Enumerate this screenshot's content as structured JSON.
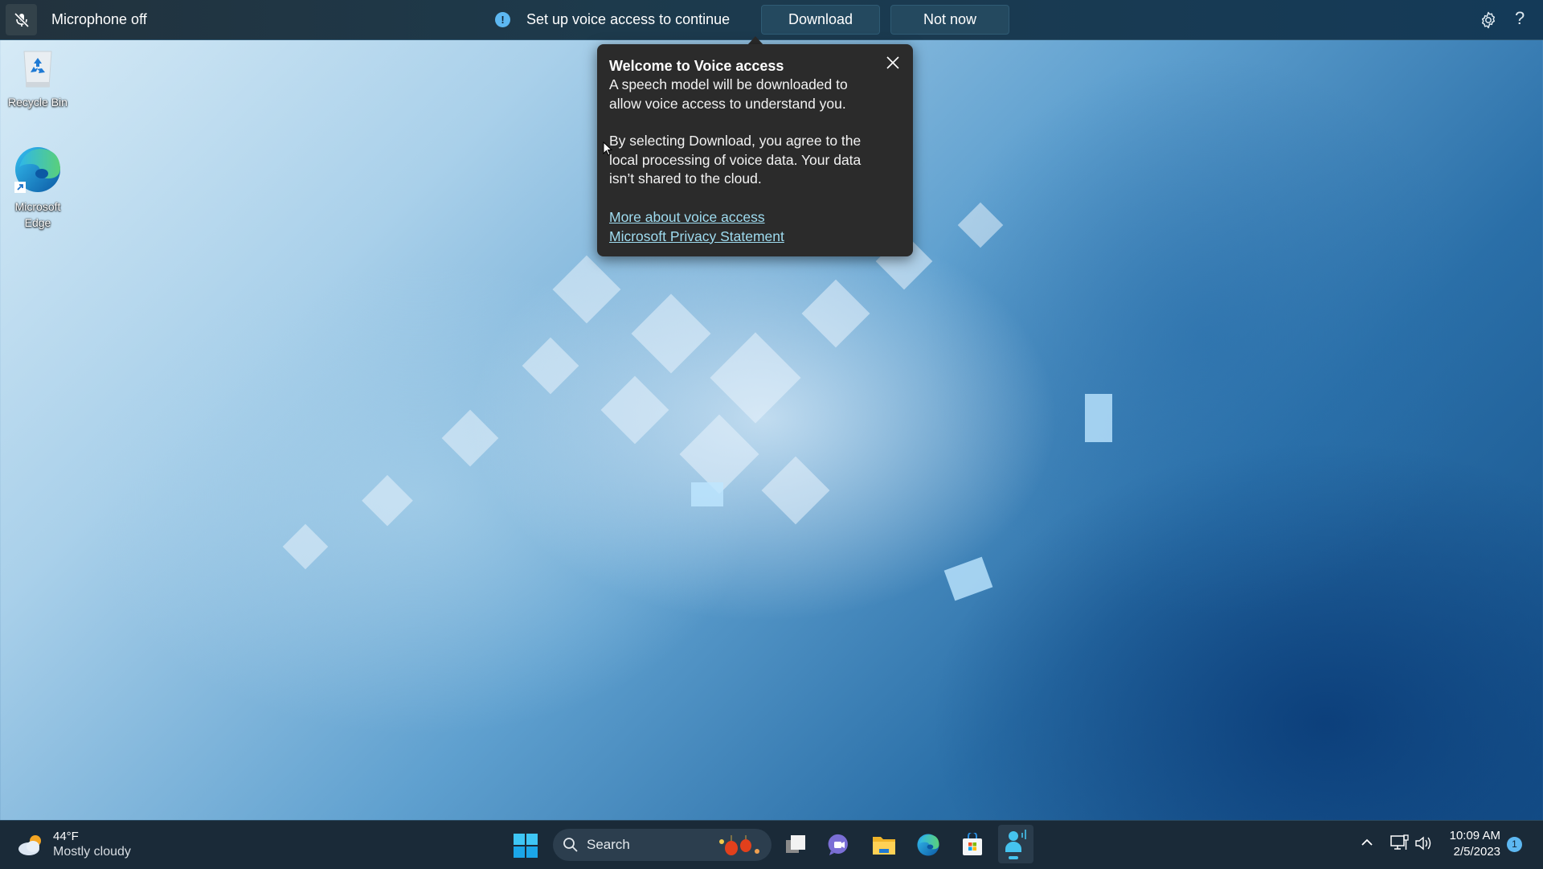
{
  "voice_bar": {
    "mic_status": "Microphone off",
    "mic_icon": "microphone-off-icon",
    "info_icon": "info-icon",
    "message": "Set up voice access to continue",
    "download_label": "Download",
    "not_now_label": "Not now",
    "settings_icon": "gear-icon",
    "help_label": "?"
  },
  "popup": {
    "title": "Welcome to Voice access",
    "line1": "A speech model will be downloaded to allow voice access to understand you.",
    "line2": "By selecting Download, you agree to the local processing of voice data. Your data isn’t shared to the cloud.",
    "link1": "More about voice access",
    "link2": "Microsoft Privacy Statement",
    "close_icon": "close-icon"
  },
  "desktop": {
    "icons": [
      {
        "label": "Recycle Bin",
        "icon": "recycle-bin-icon"
      },
      {
        "label": "Microsoft Edge",
        "icon": "edge-icon"
      }
    ]
  },
  "taskbar": {
    "weather": {
      "temp": "44°F",
      "condition": "Mostly cloudy"
    },
    "search_label": "Search",
    "apps": [
      {
        "name": "Task View",
        "icon": "task-view-icon"
      },
      {
        "name": "Chat",
        "icon": "teams-chat-icon"
      },
      {
        "name": "File Explorer",
        "icon": "file-explorer-icon"
      },
      {
        "name": "Microsoft Edge",
        "icon": "edge-icon"
      },
      {
        "name": "Microsoft Store",
        "icon": "store-icon"
      },
      {
        "name": "Voice access",
        "icon": "voice-access-icon",
        "active": true
      }
    ],
    "tray": {
      "time": "10:09 AM",
      "date": "2/5/2023",
      "notification_count": "1"
    }
  },
  "colors": {
    "accent": "#5db8f2",
    "link": "#9fdcf0",
    "popup_bg": "#2b2b2b",
    "taskbar_bg": "#1a2a38"
  }
}
